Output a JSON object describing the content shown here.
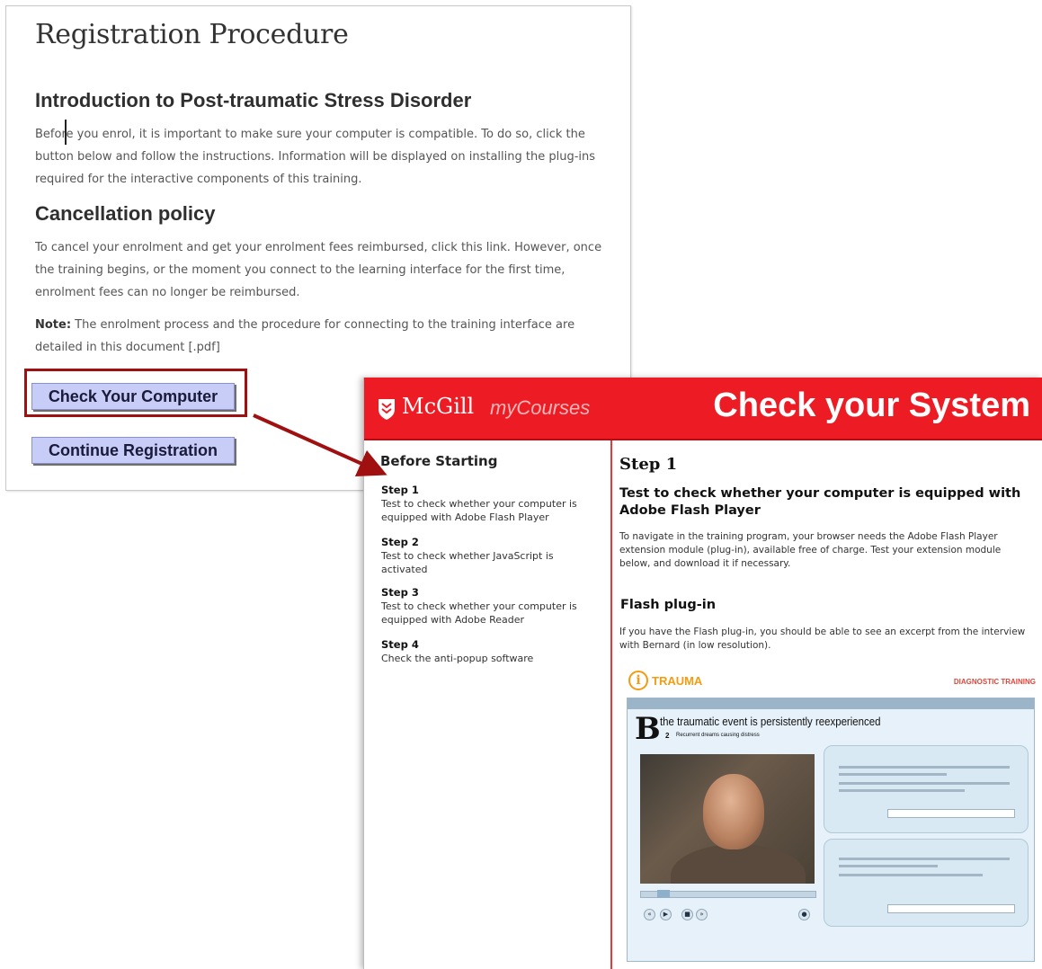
{
  "registration": {
    "title": "Registration Procedure",
    "intro_heading": "Introduction to Post-traumatic Stress Disorder",
    "intro_text": "Before you enrol, it is important to make sure your computer is compatible. To do so, click the button below and follow the instructions. Information will be displayed on installing the plug-ins required for the interactive components of this training.",
    "cancel_heading": "Cancellation policy",
    "cancel_text": "To cancel your enrolment and get your enrolment fees reimbursed, click this link. However, once the training begins, or the moment you connect to the learning interface for the first time, enrolment fees can no longer be reimbursed.",
    "note_label": "Note:",
    "note_text": " The enrolment process and the procedure for connecting to the training interface are detailed in this document [.pdf]",
    "check_button": "Check Your Computer",
    "continue_button": "Continue Registration"
  },
  "mcgill": {
    "brand": "McGill",
    "product": "myCourses",
    "page_title": "Check your System",
    "colors": {
      "header": "#ed1c24",
      "divider": "#e43a3a",
      "button": "#c8cdf8",
      "highlight": "#a01010"
    },
    "sidebar": {
      "title": "Before Starting",
      "steps": [
        {
          "label": "Step 1",
          "text": "Test to check whether your computer is equipped with Adobe Flash Player"
        },
        {
          "label": "Step 2",
          "text": "Test to check whether JavaScript is activated"
        },
        {
          "label": "Step 3",
          "text": "Test to check whether your computer is equipped with Adobe Reader"
        },
        {
          "label": "Step 4",
          "text": "Check the anti-popup software"
        }
      ]
    },
    "main": {
      "step_title": "Step 1",
      "step_subtitle": "Test to check whether your computer is equipped with Adobe Flash Player",
      "step_desc": "To navigate in the training program, your browser needs the Adobe Flash Player extension module (plug-in), available free of charge.  Test your extension module below, and download it if necessary.",
      "flash_title": "Flash plug-in",
      "flash_desc": "If you have the Flash plug-in, you should be able to see an excerpt from the interview with Bernard (in low resolution)."
    },
    "flash_preview": {
      "logo_glyph": "i",
      "logo_text": "TRAUMA",
      "right_label": "DIAGNOSTIC TRAINING",
      "letter": "B",
      "headline": "the traumatic event is persistently reexperienced",
      "sub_number": "2",
      "sub_text": "Recurrent dreams causing distress"
    }
  }
}
